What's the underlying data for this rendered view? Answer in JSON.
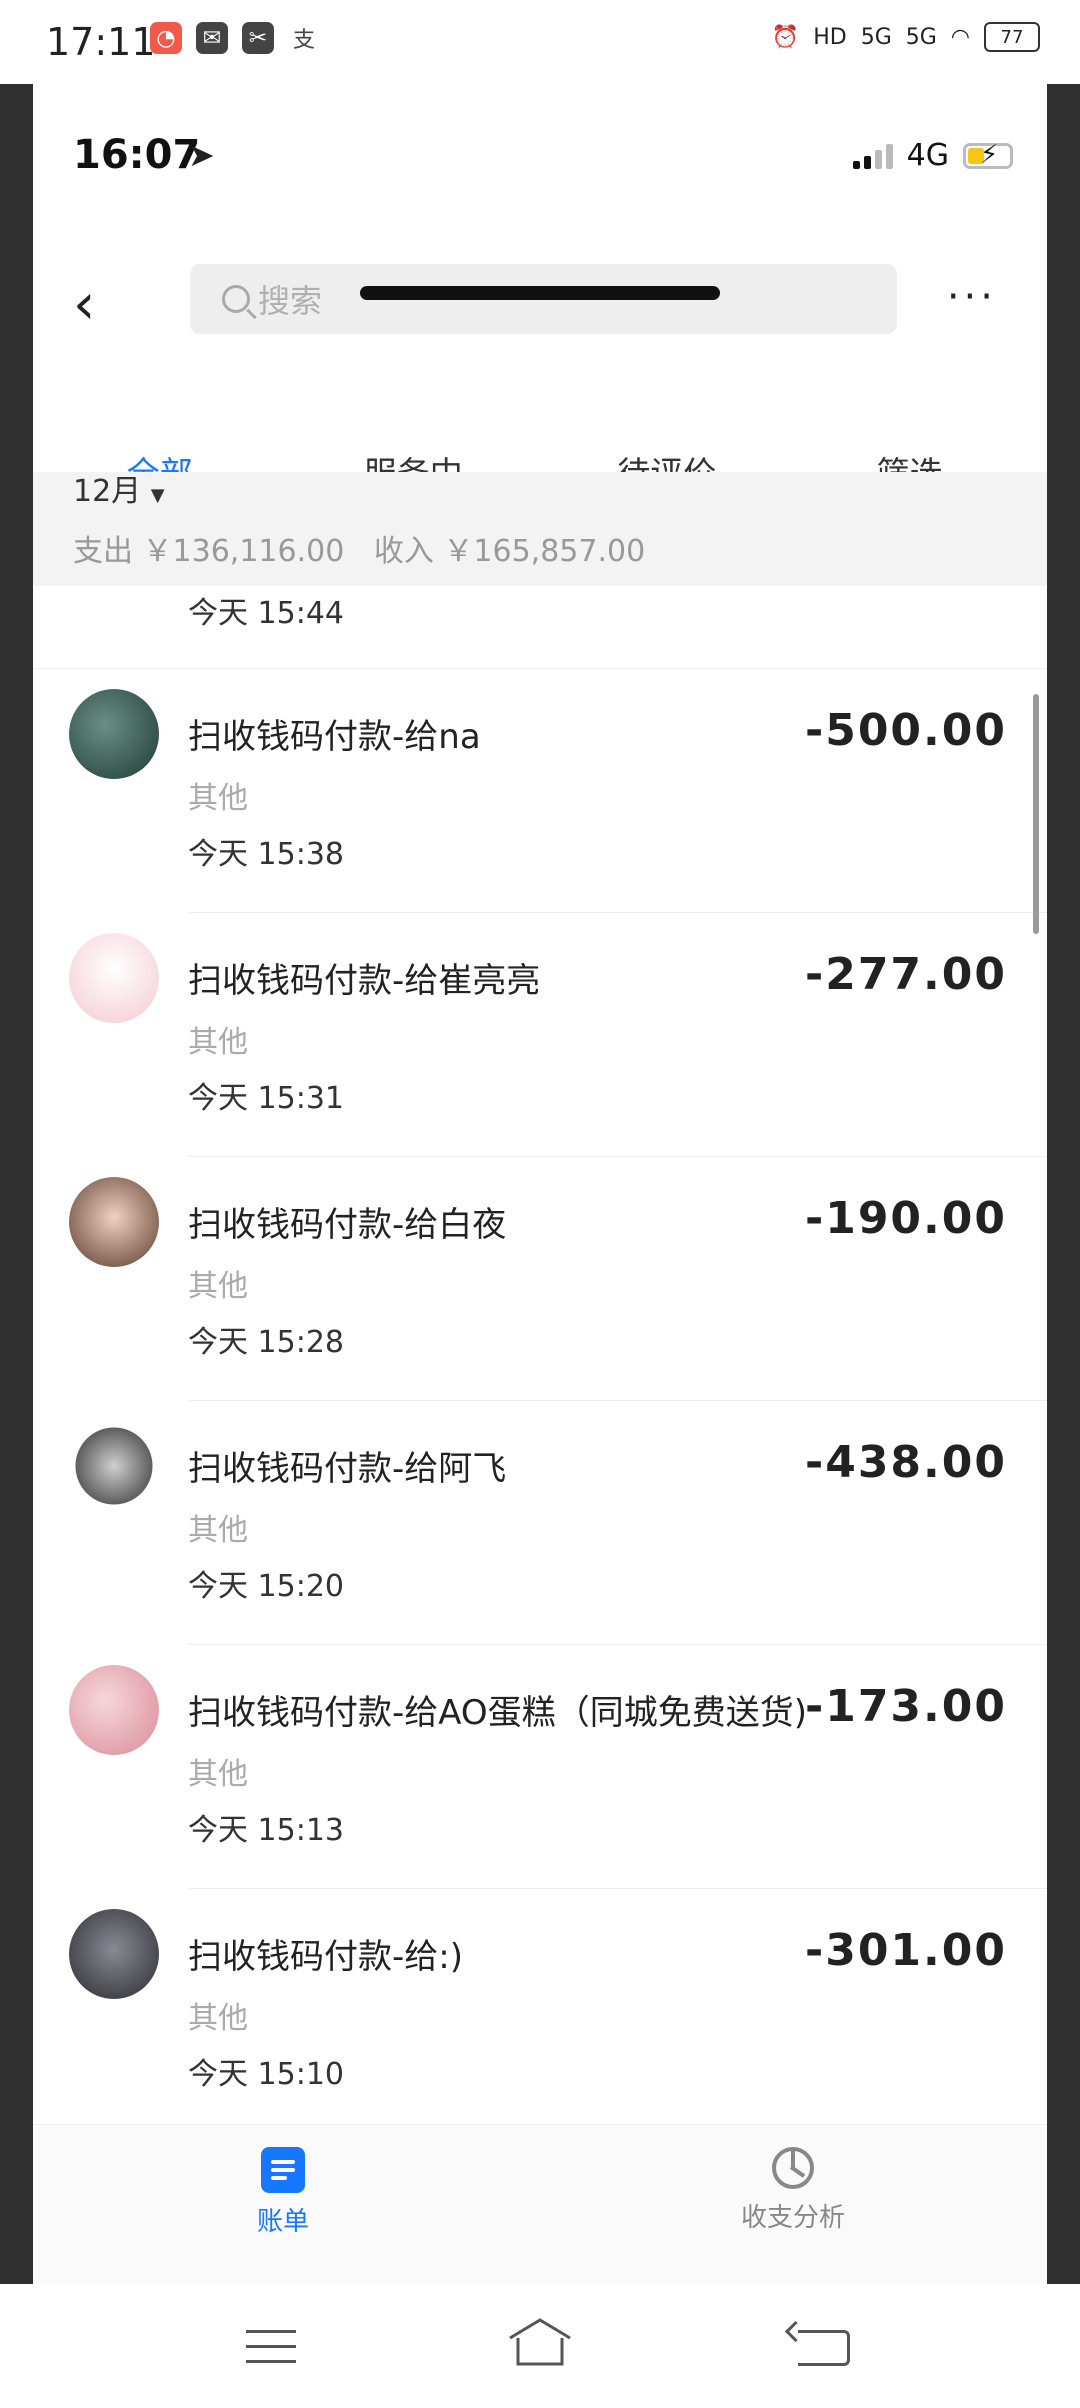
{
  "os_status": {
    "time": "17:11",
    "hd": "HD",
    "net1": "5G",
    "net2": "5G",
    "battery": "77"
  },
  "ios_status": {
    "time": "16:07",
    "network": "4G"
  },
  "nav": {
    "back": "<",
    "search_placeholder": "搜索",
    "more": "···"
  },
  "tabs": [
    {
      "label": "全部",
      "active": true
    },
    {
      "label": "服务中",
      "active": false
    },
    {
      "label": "待评价",
      "active": false
    },
    {
      "label": "筛选",
      "active": false
    }
  ],
  "summary": {
    "month": "12月",
    "expense": "支出 ￥136,116.00",
    "income": "收入 ￥165,857.00"
  },
  "prev_item_time": "今天  15:44",
  "transactions": [
    {
      "title": "扫收钱码付款-给na",
      "category": "其他",
      "time": "今天  15:38",
      "amount": "-500.00",
      "avatar_color": "#2d4f4a"
    },
    {
      "title": "扫收钱码付款-给崔亮亮",
      "category": "其他",
      "time": "今天  15:31",
      "amount": "-277.00",
      "avatar_color": "#f7dede"
    },
    {
      "title": "扫收钱码付款-给白夜",
      "category": "其他",
      "time": "今天  15:28",
      "amount": "-190.00",
      "avatar_color": "#c9a08a"
    },
    {
      "title": "扫收钱码付款-给阿飞",
      "category": "其他",
      "time": "今天  15:20",
      "amount": "-438.00",
      "avatar_color": "#8f8f8f"
    },
    {
      "title": "扫收钱码付款-给AO蛋糕（同城免费送货)",
      "category": "其他",
      "time": "今天  15:13",
      "amount": "-173.00",
      "avatar_color": "#e8a9b3"
    },
    {
      "title": "扫收钱码付款-给:)",
      "category": "其他",
      "time": "今天  15:10",
      "amount": "-301.00",
      "avatar_color": "#4a4a52"
    }
  ],
  "bottom_tabs": {
    "bill": "账单",
    "analysis": "收支分析"
  },
  "colors": {
    "accent": "#1677ff"
  }
}
